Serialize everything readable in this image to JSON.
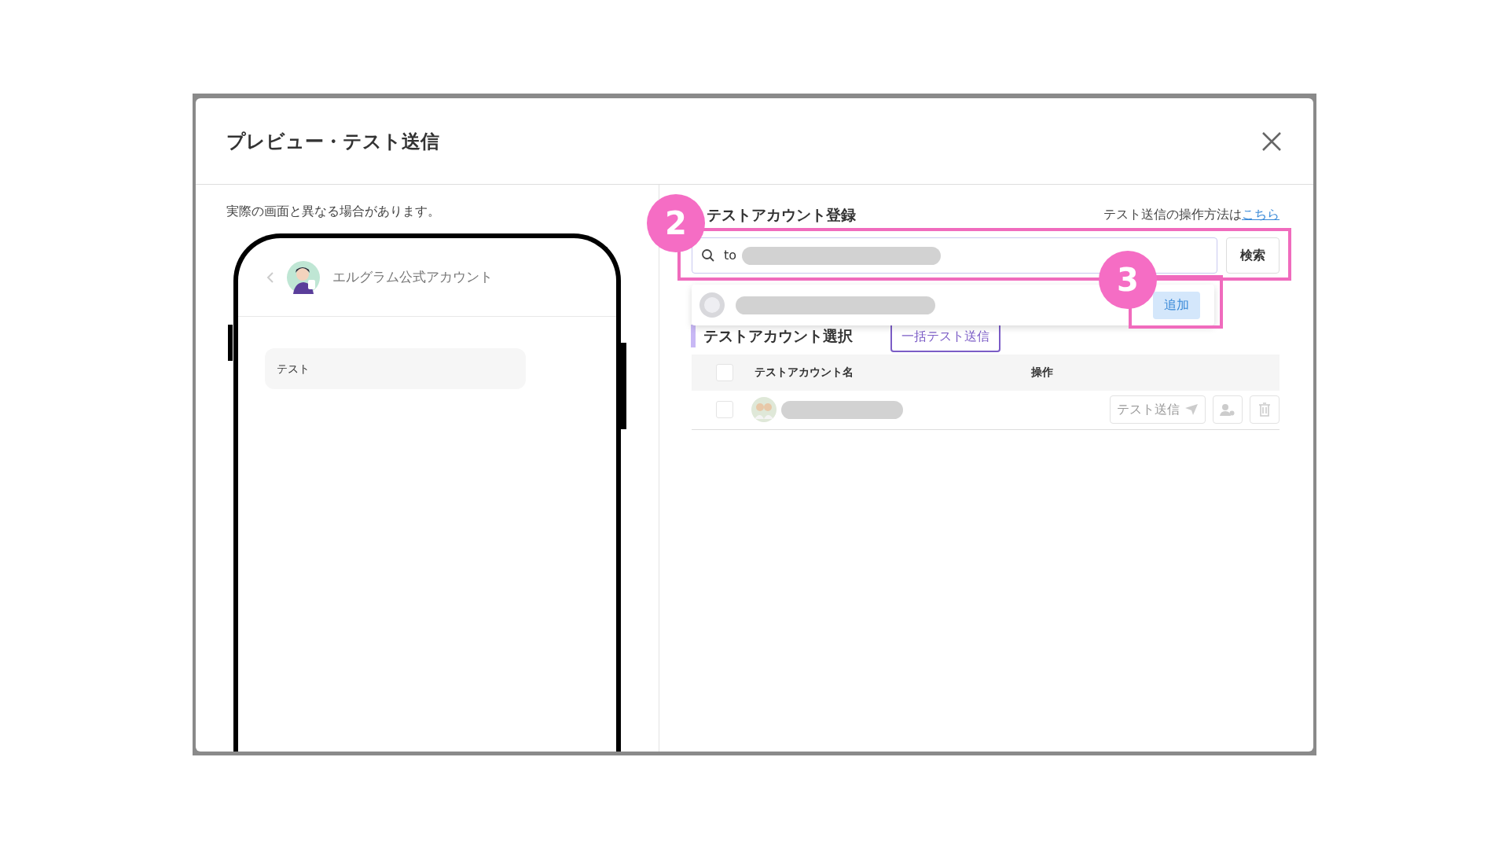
{
  "modal": {
    "title": "プレビュー・テスト送信"
  },
  "preview": {
    "notice": "実際の画面と異なる場合があります。",
    "account_name": "エルグラム公式アカウント",
    "message": "テスト"
  },
  "register": {
    "heading": "テストアカウント登録",
    "help_text": "テスト送信の操作方法は",
    "help_link": "こちら",
    "search": {
      "value": "to"
    },
    "search_button": "検索",
    "suggestion": {
      "add_button": "追加"
    }
  },
  "select": {
    "heading": "テストアカウント選択",
    "bulk_button": "一括テスト送信"
  },
  "table": {
    "select_all_checked": false,
    "columns": [
      "テストアカウント名",
      "操作"
    ],
    "rows": [
      {
        "checked": false,
        "send_button": "テスト送信"
      }
    ]
  },
  "annotations": [
    {
      "label": "2"
    },
    {
      "label": "3"
    }
  ]
}
